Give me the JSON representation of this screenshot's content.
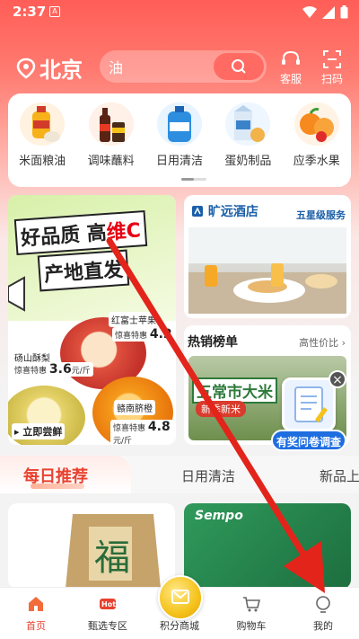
{
  "status": {
    "time": "2:37",
    "notif": "A"
  },
  "header": {
    "city": "北京",
    "search_value": "油",
    "service_label": "客服",
    "scan_label": "扫码"
  },
  "categories": [
    {
      "label": "米面粮油"
    },
    {
      "label": "调味蘸料"
    },
    {
      "label": "日用清洁"
    },
    {
      "label": "蛋奶制品"
    },
    {
      "label": "应季水果"
    }
  ],
  "banner": {
    "line1a": "好品质 高",
    "line1b": "维C",
    "line2": "产地直发",
    "tag_apple": "红富士苹果",
    "price_apple_label": "惊喜特惠",
    "price_apple": "4.2",
    "tag_pear": "砀山酥梨",
    "price_pear_label": "惊喜特惠",
    "price_pear": "3.6",
    "price_pear_unit": "元/斤",
    "tag_orange": "赣南脐橙",
    "price_orange_label": "惊喜特惠",
    "price_orange": "4.8",
    "price_orange_unit": "元/斤",
    "cta": "立即尝鲜"
  },
  "hotel": {
    "brand": "旷远酒店",
    "stars": "五星级服务"
  },
  "hot": {
    "title": "热销榜单",
    "subtitle": "高性价比 ›",
    "rice_title": "五常市大米",
    "rice_sub": "新季新米"
  },
  "survey": {
    "label": "有奖问卷调查",
    "close": "×"
  },
  "tabs": [
    {
      "label": "每日推荐"
    },
    {
      "label": "日用清洁"
    },
    {
      "label": "新品上"
    }
  ],
  "products": {
    "sempo": "Sempo"
  },
  "nav": [
    {
      "label": "首页"
    },
    {
      "label": "甄选专区",
      "badge": "Hot"
    },
    {
      "label": "积分商城"
    },
    {
      "label": "购物车"
    },
    {
      "label": "我的"
    }
  ],
  "colors": {
    "accent": "#e8412f",
    "header_red": "#ff5e57",
    "arrow": "#e3241b"
  }
}
